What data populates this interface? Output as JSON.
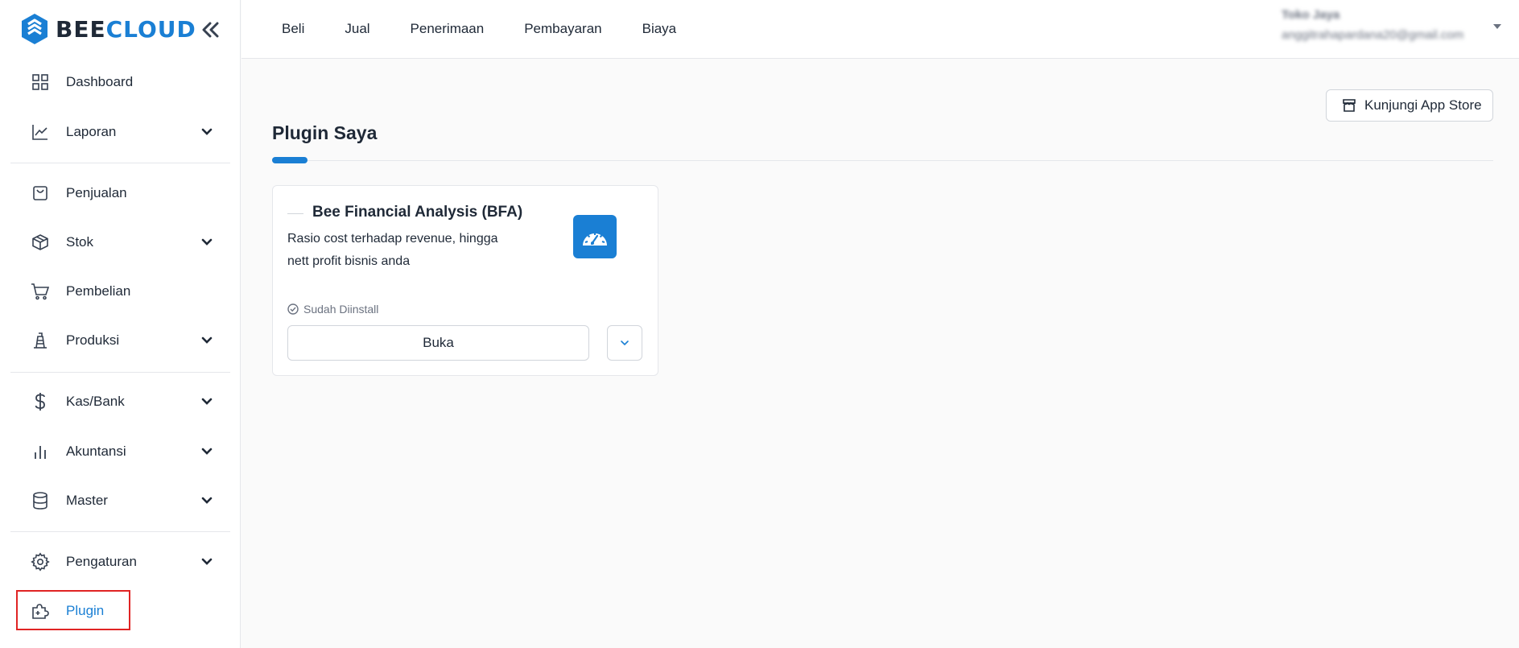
{
  "brand": {
    "part1": "BEE",
    "part2": "CLOUD",
    "accent": "#1a7fd4"
  },
  "sidebar": {
    "items": [
      {
        "label": "Dashboard",
        "icon": "grid-icon",
        "expandable": false
      },
      {
        "label": "Laporan",
        "icon": "line-chart-icon",
        "expandable": true
      },
      {
        "label": "Penjualan",
        "icon": "shopping-bag-icon",
        "expandable": false
      },
      {
        "label": "Stok",
        "icon": "box-icon",
        "expandable": true
      },
      {
        "label": "Pembelian",
        "icon": "cart-icon",
        "expandable": false
      },
      {
        "label": "Produksi",
        "icon": "factory-icon",
        "expandable": true
      },
      {
        "label": "Kas/Bank",
        "icon": "dollar-icon",
        "expandable": true
      },
      {
        "label": "Akuntansi",
        "icon": "bar-chart-icon",
        "expandable": true
      },
      {
        "label": "Master",
        "icon": "database-icon",
        "expandable": true
      },
      {
        "label": "Pengaturan",
        "icon": "gear-icon",
        "expandable": true
      },
      {
        "label": "Plugin",
        "icon": "puzzle-icon",
        "expandable": false,
        "active": true
      }
    ]
  },
  "topnav": {
    "items": [
      "Beli",
      "Jual",
      "Penerimaan",
      "Pembayaran",
      "Biaya"
    ]
  },
  "user": {
    "name": "Toko Jaya",
    "email": "anggitrahapardana20@gmail.com"
  },
  "main": {
    "app_store_label": "Kunjungi App Store",
    "title": "Plugin Saya",
    "plugin": {
      "title": "Bee Financial Analysis (BFA)",
      "description": "Rasio cost terhadap revenue, hingga nett profit bisnis anda",
      "status": "Sudah Diinstall",
      "open_label": "Buka"
    }
  }
}
